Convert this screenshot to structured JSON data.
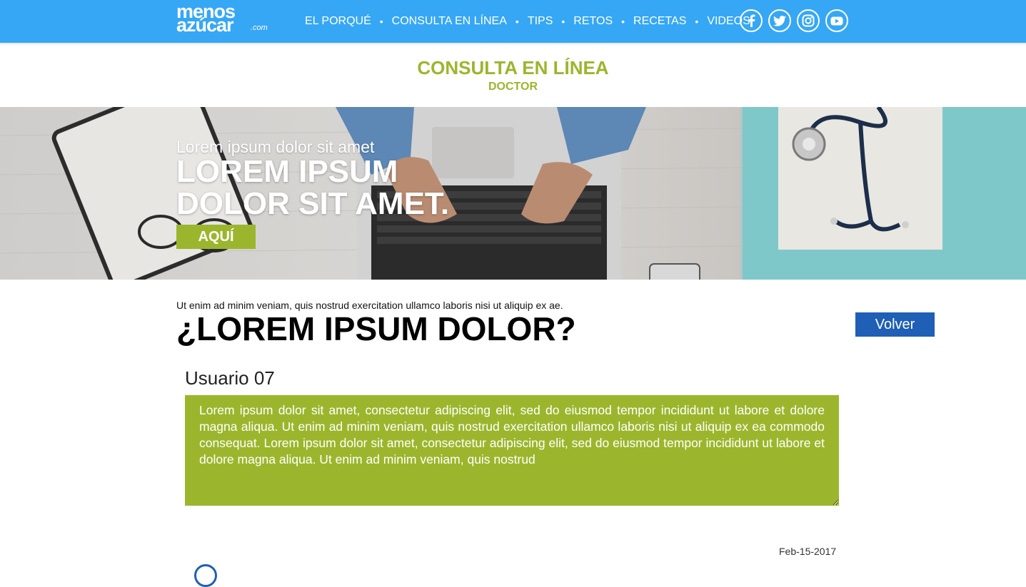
{
  "brand": {
    "logo_top": "menos",
    "logo_bottom": "azúcar",
    "logo_suffix": ".com"
  },
  "nav": {
    "items": [
      {
        "label": "EL PORQUÉ"
      },
      {
        "label": "CONSULTA EN LÍNEA"
      },
      {
        "label": "TIPS"
      },
      {
        "label": "RETOS"
      },
      {
        "label": "RECETAS"
      },
      {
        "label": "VIDEOS"
      }
    ],
    "separator": "•"
  },
  "social": {
    "icons": [
      "facebook-icon",
      "twitter-icon",
      "instagram-icon",
      "youtube-icon"
    ]
  },
  "page": {
    "title": "CONSULTA EN LÍNEA",
    "subtitle": "DOCTOR"
  },
  "hero": {
    "kicker": "Lorem ipsum dolor sit amet",
    "headline_line1": "LOREM IPSUM",
    "headline_line2": "DOLOR SIT AMET.",
    "button_label": "AQUÍ"
  },
  "content": {
    "lead": "Ut enim ad minim veniam, quis nostrud exercitation ullamco laboris nisi ut aliquip ex ae.",
    "question": "¿LOREM IPSUM DOLOR?",
    "back_button": "Volver",
    "username": "Usuario 07",
    "message": "Lorem ipsum dolor sit amet, consectetur adipiscing elit, sed do eiusmod tempor incididunt ut labore et dolore magna aliqua. Ut enim ad minim veniam, quis nostrud exercitation ullamco laboris nisi ut aliquip ex ea commodo consequat. Lorem ipsum dolor sit amet, consectetur adipiscing elit, sed do eiusmod tempor incididunt ut labore et dolore magna aliqua. Ut enim ad minim veniam, quis nostrud",
    "date": "Feb-15-2017"
  },
  "colors": {
    "header_blue": "#36a7f5",
    "accent_green": "#9bb62c",
    "button_blue": "#1f5fb6"
  }
}
